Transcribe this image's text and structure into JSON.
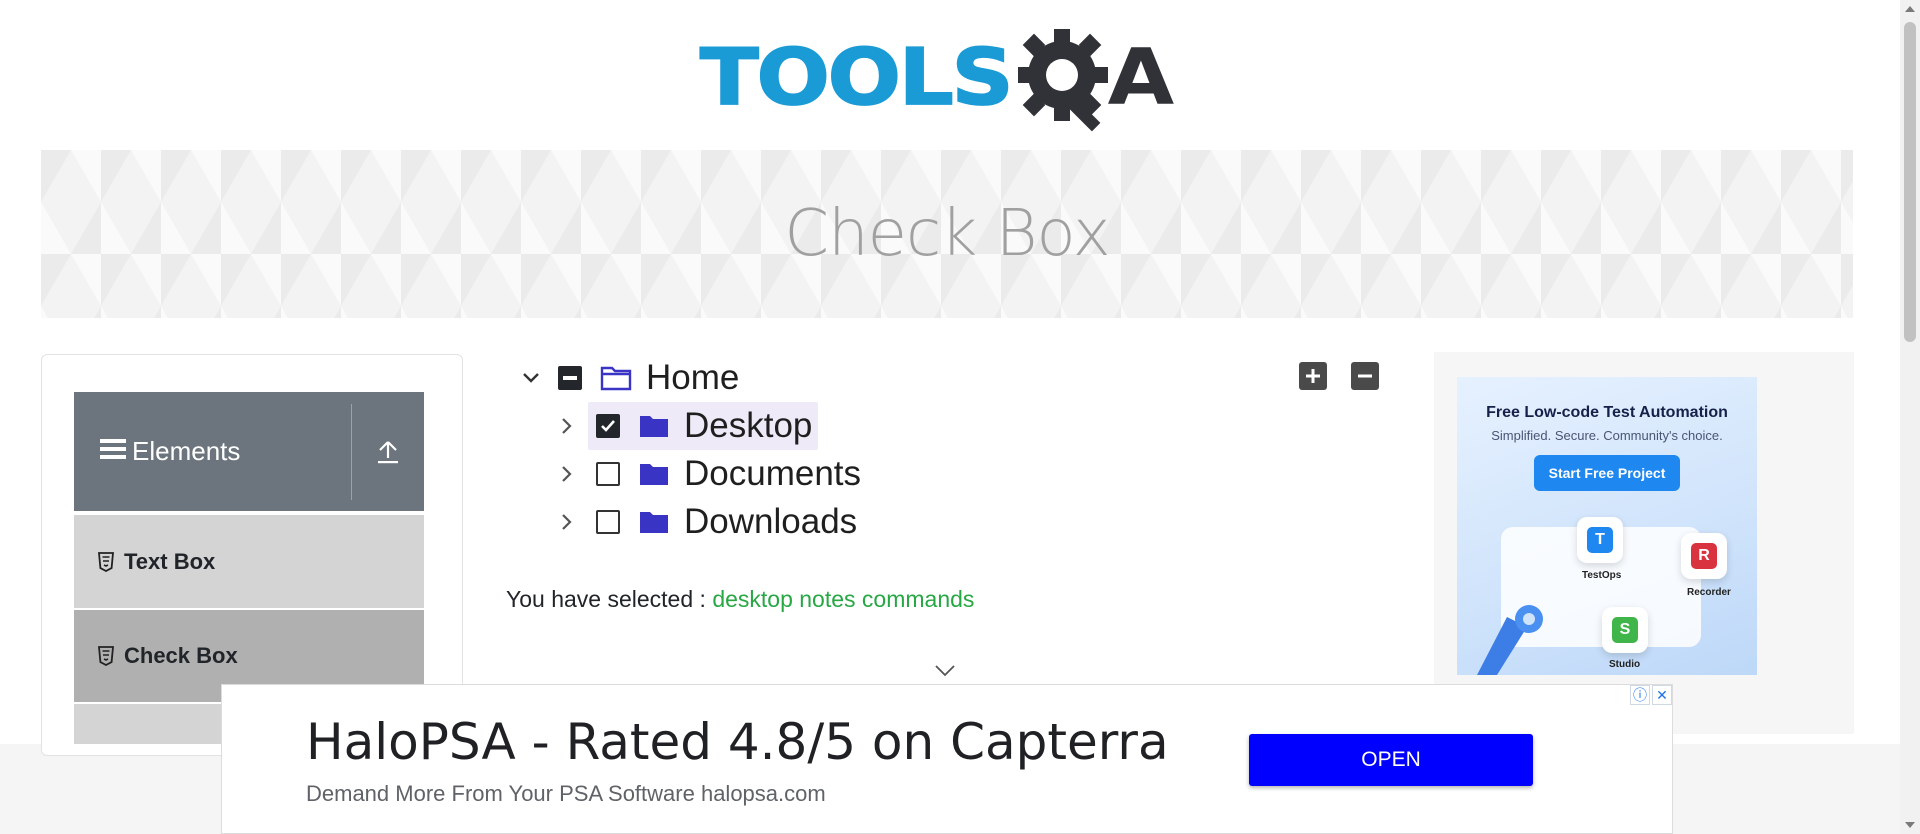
{
  "header": {
    "logo_text": "TOOLS",
    "logo_suffix": "A",
    "logo_alt": "TOOLSQA"
  },
  "page": {
    "title": "Check Box"
  },
  "sidebar": {
    "group_title": "Elements",
    "items": [
      {
        "label": "Text Box"
      },
      {
        "label": "Check Box"
      }
    ]
  },
  "tree": {
    "root": {
      "label": "Home",
      "state": "partial",
      "expanded": true
    },
    "children": [
      {
        "label": "Desktop",
        "state": "checked",
        "expanded": false
      },
      {
        "label": "Documents",
        "state": "unchecked",
        "expanded": false
      },
      {
        "label": "Downloads",
        "state": "unchecked",
        "expanded": false
      }
    ],
    "expand_all_icon": "plus-icon",
    "collapse_all_icon": "minus-icon"
  },
  "result": {
    "prefix": "You have selected :",
    "values": "desktop notes commands"
  },
  "side_ad": {
    "headline": "Free Low-code Test Automation",
    "subline": "Simplified. Secure. Community's choice.",
    "cta": "Start Free Project",
    "tiles": [
      "TestOps",
      "Recorder",
      "Studio"
    ]
  },
  "bottom_ad": {
    "title": "HaloPSA - Rated 4.8/5 on Capterra",
    "subtitle": "Demand More From Your PSA Software halopsa.com",
    "cta": "OPEN"
  },
  "colors": {
    "brand_blue": "#1b9bd6",
    "sidebar_header": "#6c757d",
    "result_green": "#28a745",
    "ad_button": "#0000ff",
    "folder": "#3a34c4"
  }
}
